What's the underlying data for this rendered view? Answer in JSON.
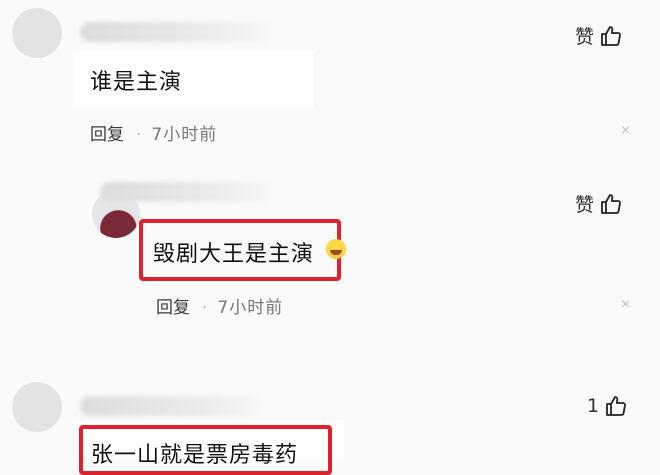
{
  "comments": [
    {
      "text": "谁是主演",
      "reply_label": "回复",
      "separator": "·",
      "time": "7小时前",
      "like_label": "赞",
      "close_glyph": "×"
    },
    {
      "text": "毁剧大王是主演",
      "reply_label": "回复",
      "separator": "·",
      "time": "7小时前",
      "like_label": "赞",
      "close_glyph": "×"
    },
    {
      "text": "张一山就是票房毒药",
      "like_label": "1"
    }
  ],
  "colors": {
    "highlight": "#e0202c",
    "background": "#fafafa"
  },
  "icons": [
    "thumbs-up-icon",
    "close-icon",
    "avatar",
    "emoji-icon"
  ]
}
